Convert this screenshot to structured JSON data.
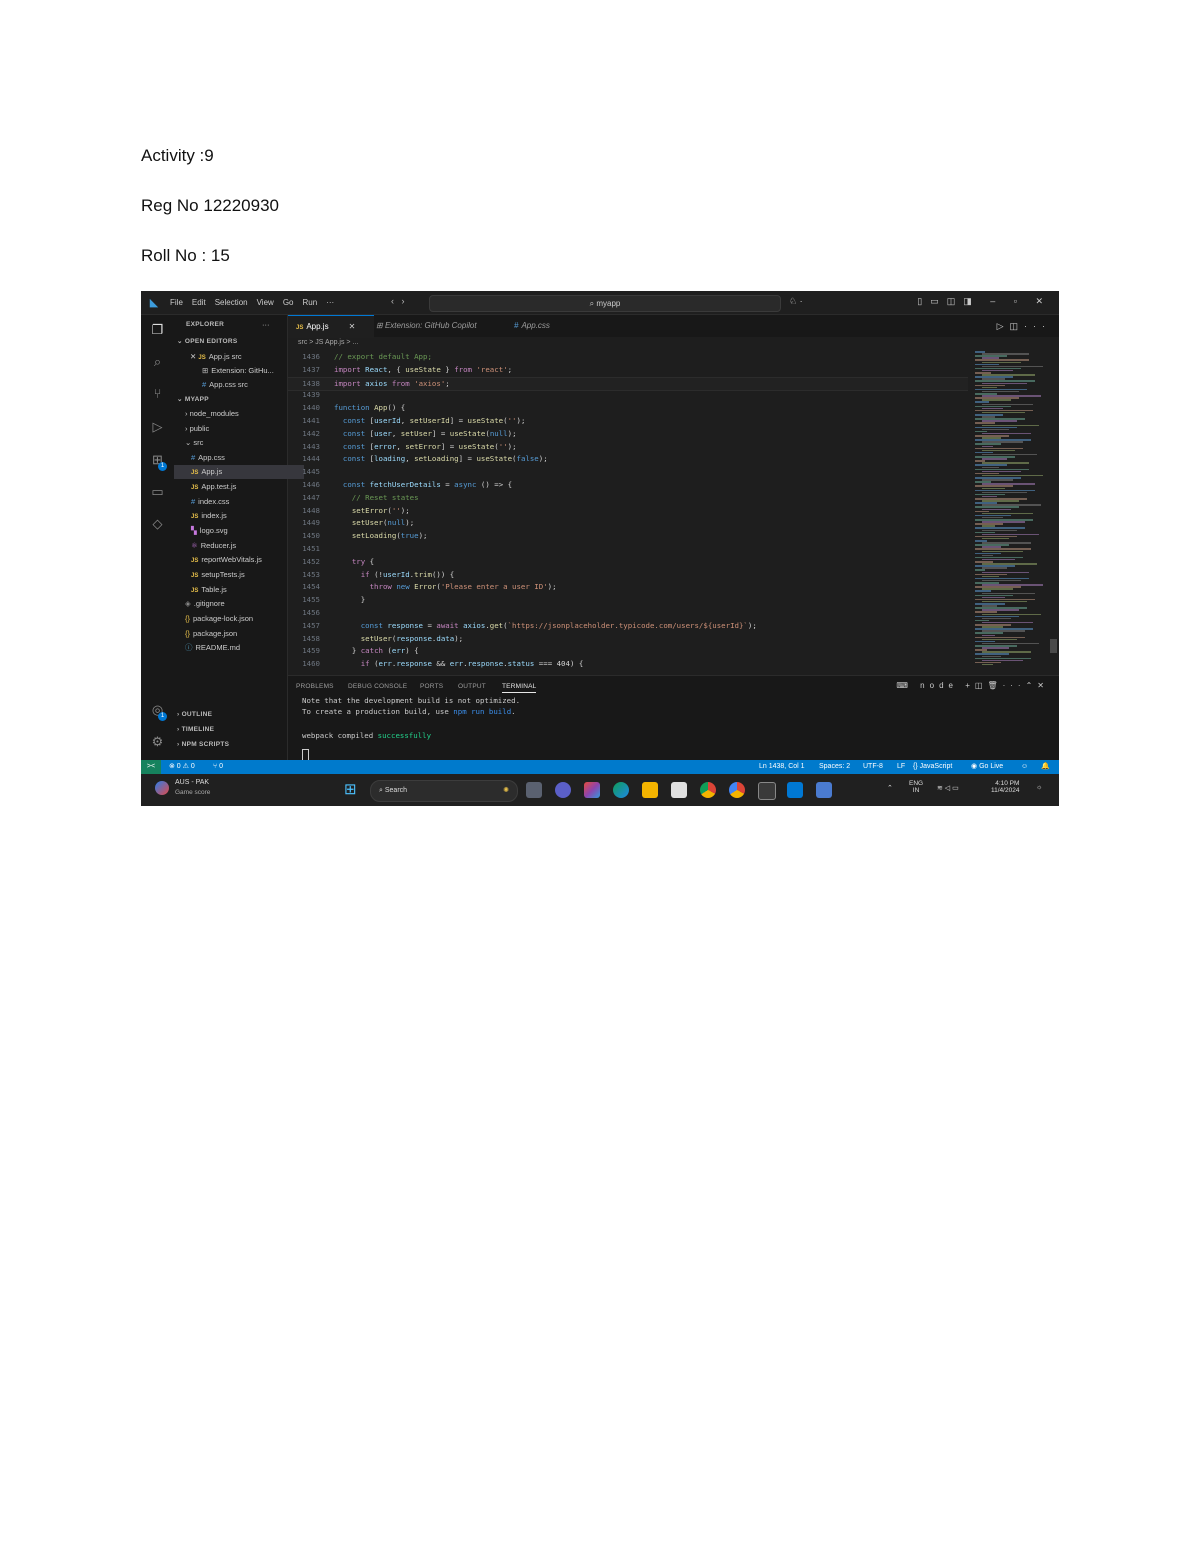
{
  "document": {
    "activity": "Activity :9",
    "reg": "Reg No 12220930",
    "roll": "Roll No : 15"
  },
  "vscode": {
    "menu": [
      "File",
      "Edit",
      "Selection",
      "View",
      "Go",
      "Run",
      "···"
    ],
    "search_box": "myapp",
    "explorer": {
      "title": "EXPLORER",
      "more": "···",
      "open_editors_title": "OPEN EDITORS",
      "open_editors": [
        "App.js src",
        "Extension: GitHu...",
        "App.css src"
      ],
      "project": "MYAPP",
      "tree": [
        "node_modules",
        "public",
        "src",
        "App.css",
        "App.js",
        "App.test.js",
        "index.css",
        "index.js",
        "logo.svg",
        "Reducer.js",
        "reportWebVitals.js",
        "setupTests.js",
        "Table.js",
        ".gitignore",
        "package-lock.json",
        "package.json",
        "README.md"
      ],
      "outline": "OUTLINE",
      "timeline": "TIMELINE",
      "npm_scripts": "NPM SCRIPTS"
    },
    "tabs": [
      "App.js",
      "Extension: GitHub Copilot",
      "App.css"
    ],
    "breadcrumb": "src > JS App.js > ...",
    "code_lines": [
      {
        "n": "1436",
        "t": "// export default App;"
      },
      {
        "n": "1437",
        "t": "import React, { useState } from 'react';"
      },
      {
        "n": "1438",
        "t": "import axios from 'axios';"
      },
      {
        "n": "1439",
        "t": ""
      },
      {
        "n": "1440",
        "t": "function App() {"
      },
      {
        "n": "1441",
        "t": "  const [userId, setUserId] = useState('');"
      },
      {
        "n": "1442",
        "t": "  const [user, setUser] = useState(null);"
      },
      {
        "n": "1443",
        "t": "  const [error, setError] = useState('');"
      },
      {
        "n": "1444",
        "t": "  const [loading, setLoading] = useState(false);"
      },
      {
        "n": "1445",
        "t": ""
      },
      {
        "n": "1446",
        "t": "  const fetchUserDetails = async () => {"
      },
      {
        "n": "1447",
        "t": "    // Reset states"
      },
      {
        "n": "1448",
        "t": "    setError('');"
      },
      {
        "n": "1449",
        "t": "    setUser(null);"
      },
      {
        "n": "1450",
        "t": "    setLoading(true);"
      },
      {
        "n": "1451",
        "t": ""
      },
      {
        "n": "1452",
        "t": "    try {"
      },
      {
        "n": "1453",
        "t": "      if (!userId.trim()) {"
      },
      {
        "n": "1454",
        "t": "        throw new Error('Please enter a user ID');"
      },
      {
        "n": "1455",
        "t": "      }"
      },
      {
        "n": "1456",
        "t": ""
      },
      {
        "n": "1457",
        "t": "      const response = await axios.get(`https://jsonplaceholder.typicode.com/users/${userId}`);"
      },
      {
        "n": "1458",
        "t": "      setUser(response.data);"
      },
      {
        "n": "1459",
        "t": "    } catch (err) {"
      },
      {
        "n": "1460",
        "t": "      if (err.response && err.response.status === 404) {"
      }
    ],
    "panel_tabs": [
      "PROBLEMS",
      "DEBUG CONSOLE",
      "PORTS",
      "OUTPUT",
      "TERMINAL"
    ],
    "panel_node": "node",
    "terminal": {
      "line1": "Note that the development build is not optimized.",
      "line2_pre": "To create a production build, use ",
      "line2_cmd": "npm run build",
      "line2_post": ".",
      "line3_pre": "webpack compiled ",
      "line3_ok": "successfully"
    },
    "status": {
      "remote": "><",
      "problems": "⊗ 0 ⚠ 0",
      "ports": "⑂ 0",
      "position": "Ln 1438, Col 1",
      "spaces": "Spaces: 2",
      "encoding": "UTF-8",
      "eol": "LF",
      "language": "{} JavaScript",
      "golive": "Go Live"
    },
    "taskbar": {
      "weather_title": "AUS - PAK",
      "weather_sub": "Game score",
      "search": "Search",
      "lang": "ENG",
      "lang_sub": "IN",
      "time": "4:10 PM",
      "date": "11/4/2024"
    },
    "colors": {
      "keyword": "#569cd6",
      "control": "#c586c0",
      "string": "#ce9178",
      "function": "#dcdcaa",
      "variable": "#9cdcfe",
      "comment": "#6a9955",
      "status_blue": "#007acc"
    }
  }
}
